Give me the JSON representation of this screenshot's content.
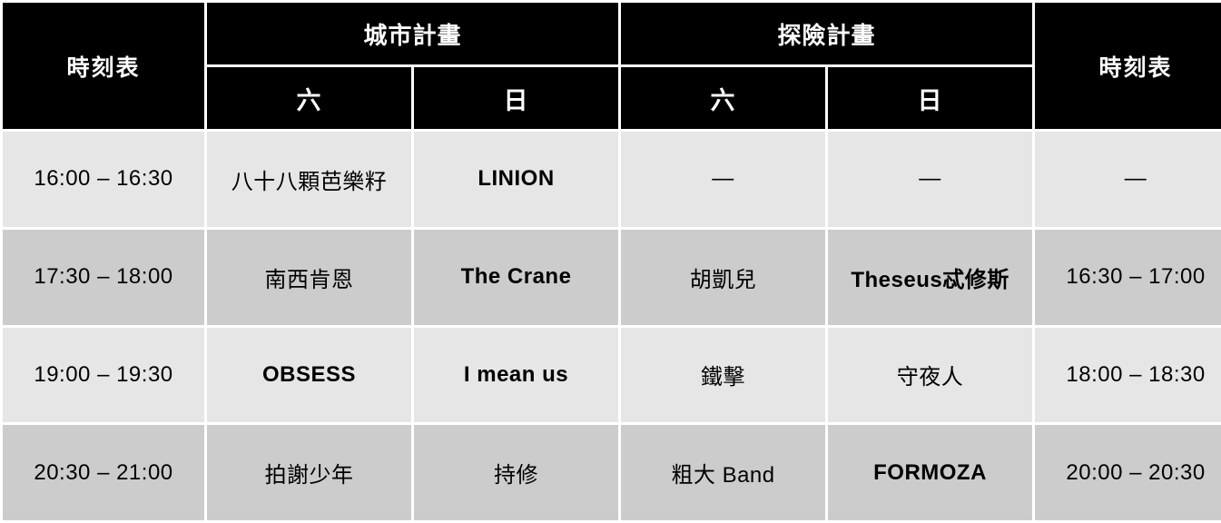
{
  "header": {
    "time_label_left": "時刻表",
    "time_label_right": "時刻表",
    "groups": [
      {
        "name": "城市計畫",
        "days": [
          "六",
          "日"
        ]
      },
      {
        "name": "探險計畫",
        "days": [
          "六",
          "日"
        ]
      }
    ]
  },
  "rows": [
    {
      "time_left": "16:00 – 16:30",
      "city_sat": "八十八顆芭樂籽",
      "city_sun": "LINION",
      "adv_sat": "—",
      "adv_sun": "—",
      "time_right": "—"
    },
    {
      "time_left": "17:30 – 18:00",
      "city_sat": "南西肯恩",
      "city_sun": "The Crane",
      "adv_sat": "胡凱兒",
      "adv_sun": "Theseus忒修斯",
      "time_right": "16:30 – 17:00"
    },
    {
      "time_left": "19:00 – 19:30",
      "city_sat": "OBSESS",
      "city_sun": "I mean us",
      "adv_sat": "鐵擊",
      "adv_sun": "守夜人",
      "time_right": "18:00 – 18:30"
    },
    {
      "time_left": "20:30 – 21:00",
      "city_sat": "拍謝少年",
      "city_sun": "持修",
      "adv_sat": "粗大 Band",
      "adv_sun": "FORMOZA",
      "time_right": "20:00 – 20:30"
    }
  ],
  "colors": {
    "header_bg": "#000000",
    "header_text": "#ffffff",
    "row_light": "#e6e6e6",
    "row_dark": "#cccccc",
    "grid": "#ffffff",
    "body_text": "#000000"
  }
}
